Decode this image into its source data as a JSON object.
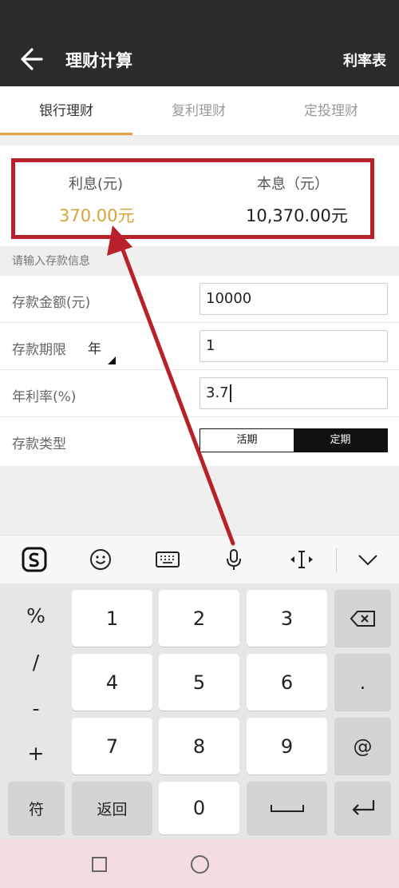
{
  "header": {
    "title": "理财计算",
    "right_link": "利率表"
  },
  "tabs": [
    {
      "label": "银行理财",
      "active": true
    },
    {
      "label": "复利理财",
      "active": false
    },
    {
      "label": "定投理财",
      "active": false
    }
  ],
  "results": {
    "interest_label": "利息(元)",
    "interest_value": "370.00元",
    "total_label": "本息（元）",
    "total_value": "10,370.00元"
  },
  "form": {
    "section_hint": "请输入存款信息",
    "amount_label": "存款金额(元)",
    "amount_value": "10000",
    "term_label": "存款期限",
    "term_unit": "年",
    "term_value": "1",
    "rate_label": "年利率(%)",
    "rate_value": "3.7",
    "type_label": "存款类型",
    "type_options": [
      "活期",
      "定期"
    ],
    "type_selected": "定期"
  },
  "keyboard": {
    "symbols": [
      "%",
      "/",
      "-",
      "+"
    ],
    "digits": [
      "1",
      "2",
      "3",
      "4",
      "5",
      "6",
      "7",
      "8",
      "9",
      "0"
    ],
    "dot": ".",
    "at": "@",
    "symbol_key": "符",
    "return_key": "返回"
  },
  "colors": {
    "accent": "#e0a447",
    "highlight_frame": "#b9212a",
    "interest_text": "#d6a53a",
    "header_bg": "#2b2b2b"
  }
}
